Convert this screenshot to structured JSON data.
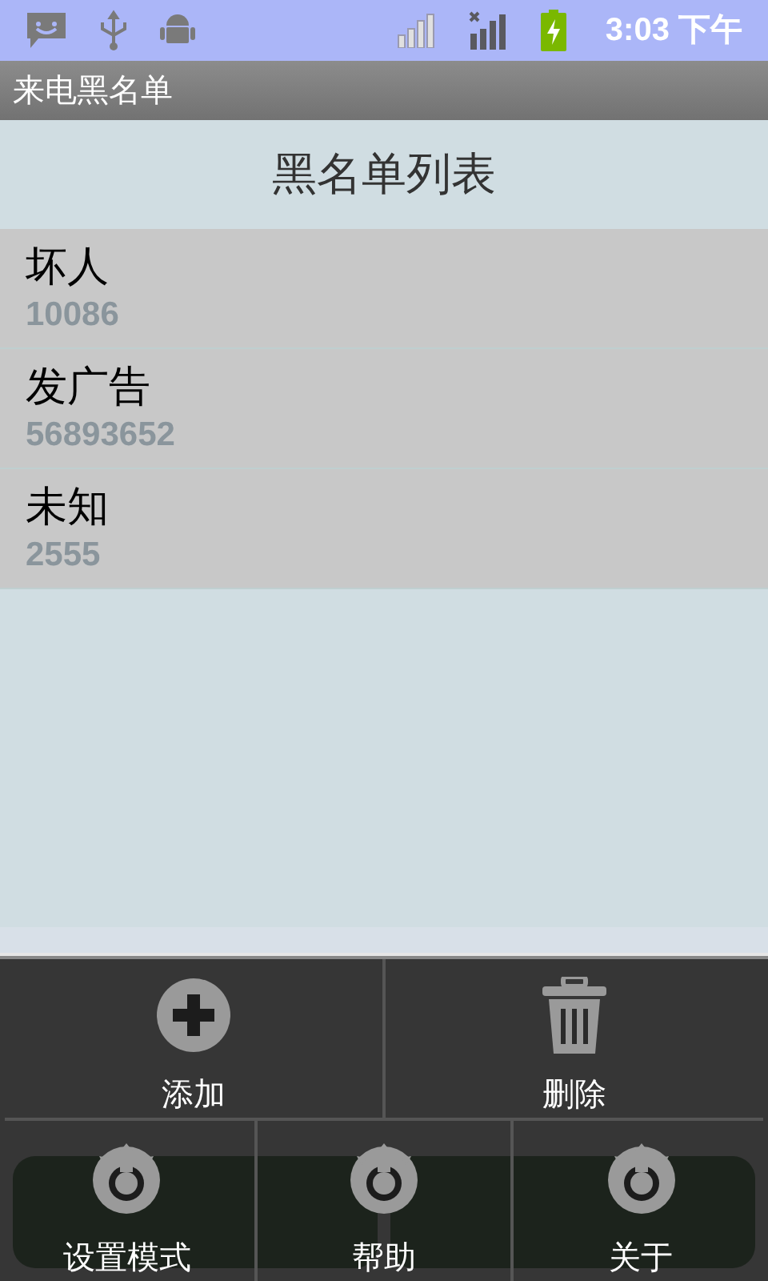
{
  "status_bar": {
    "time": "3:03 下午"
  },
  "app_bar": {
    "title": "来电黑名单"
  },
  "list": {
    "heading": "黑名单列表",
    "items": [
      {
        "name": "坏人",
        "number": "10086"
      },
      {
        "name": "发广告",
        "number": "56893652"
      },
      {
        "name": "未知",
        "number": "2555"
      }
    ]
  },
  "options_menu": {
    "rows": [
      [
        {
          "label": "添加",
          "kind": "add"
        },
        {
          "label": "删除",
          "kind": "delete"
        }
      ],
      [
        {
          "label": "设置模式",
          "kind": "gear"
        },
        {
          "label": "帮助",
          "kind": "gear"
        },
        {
          "label": "关于",
          "kind": "gear"
        }
      ]
    ]
  }
}
